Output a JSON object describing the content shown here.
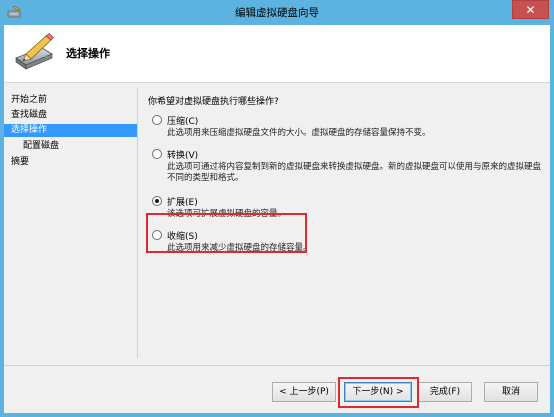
{
  "window": {
    "title": "编辑虚拟硬盘向导",
    "close_glyph": "✕"
  },
  "header": {
    "title": "选择操作",
    "icon": "pencil-disk-icon"
  },
  "nav": {
    "items": [
      {
        "label": "开始之前"
      },
      {
        "label": "查找磁盘"
      },
      {
        "label": "选择操作"
      },
      {
        "label": "配置磁盘"
      },
      {
        "label": "摘要"
      }
    ],
    "active_index": 2
  },
  "main": {
    "question": "你希望对虚拟硬盘执行哪些操作?",
    "options": [
      {
        "label": "压缩(C)",
        "description": "此选项用来压缩虚拟硬盘文件的大小。虚拟硬盘的存储容量保持不变。",
        "checked": false
      },
      {
        "label": "转换(V)",
        "description": "此选项可通过将内容复制到新的虚拟硬盘来转换虚拟硬盘。新的虚拟硬盘可以使用与原来的虚拟硬盘不同的类型和格式。",
        "checked": false
      },
      {
        "label": "扩展(E)",
        "description": "该选项可扩展虚拟硬盘的容量。",
        "checked": true
      },
      {
        "label": "收缩(S)",
        "description": "此选项用来减少虚拟硬盘的存储容量。",
        "checked": false
      }
    ]
  },
  "footer": {
    "prev_label": "< 上一步(P)",
    "next_label": "下一步(N) >",
    "finish_label": "完成(F)",
    "cancel_label": "取消"
  },
  "colors": {
    "titlebar": "#5cb3e0",
    "nav_active": "#3399ff",
    "highlight": "#e0282e",
    "close": "#c75050"
  }
}
